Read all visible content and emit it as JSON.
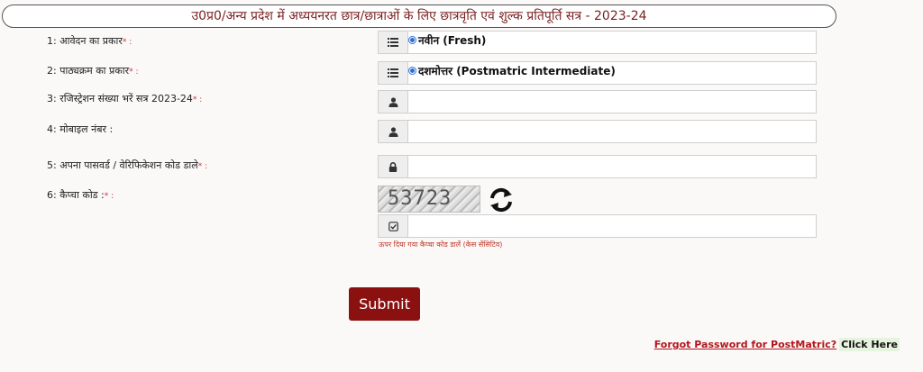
{
  "header": {
    "title": "उ0प्र0/अन्य प्रदेश में अध्ययनरत छात्र/छात्राओं के लिए छात्रवृति एवं शुल्क प्रतिपूर्ति सत्र - 2023-24"
  },
  "form": {
    "fields": [
      {
        "label": "1: आवेदन का प्रकार",
        "required_mark": "* :",
        "type": "radio",
        "icon": "list-icon",
        "value": "नवीन (Fresh)"
      },
      {
        "label": "2: पाठ्यक्रम का प्रकार",
        "required_mark": "* :",
        "type": "radio",
        "icon": "list-icon",
        "value": "दशमोत्तर (Postmatric Intermediate)"
      },
      {
        "label": "3: रजिस्ट्रेशन संख्या भरें सत्र 2023-24",
        "required_mark": "* :",
        "type": "text",
        "icon": "user-icon",
        "value": ""
      },
      {
        "label": "4: मोबाइल नंबर :",
        "required_mark": "",
        "type": "text",
        "icon": "user-icon",
        "value": ""
      },
      {
        "label": "5: अपना पासवर्ड / वेरिफिकेशन कोड डाले",
        "required_mark": "* :",
        "type": "password",
        "icon": "lock-icon",
        "value": ""
      },
      {
        "label": "6: कैप्चा कोड :",
        "required_mark": "* :",
        "type": "captcha",
        "icon": "check-square-icon",
        "value": ""
      }
    ],
    "captcha": {
      "code": "53723",
      "hint": "ऊपर दिया गया कैप्चा कोड डालें (केस सेंसिटिव)"
    },
    "submit_label": "Submit"
  },
  "footer": {
    "forgot_text": "Forgot Password for PostMatric?",
    "click_text": "Click Here"
  },
  "colors": {
    "accent": "#8b1111",
    "link": "#b3151b",
    "radio": "#2a6fd6"
  }
}
